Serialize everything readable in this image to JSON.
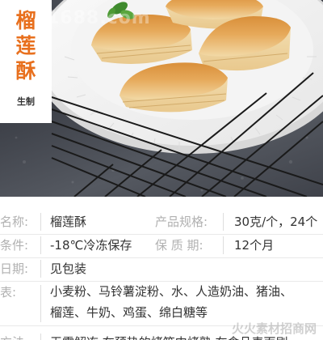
{
  "hero": {
    "title_chars": [
      "榴",
      "莲",
      "酥"
    ],
    "subtitle": "生制",
    "watermark_top": "1688.com",
    "watermark_bottom": "火火素材招商网"
  },
  "info": {
    "row1": {
      "label": "名称:",
      "value": "榴莲酥",
      "label2": "产品规格:",
      "value2": "30克/个，24个"
    },
    "row2": {
      "label": "条件:",
      "value": "-18℃冷冻保存",
      "label2": "保 质 期:",
      "value2": "12个月"
    },
    "row3": {
      "label": "日期:",
      "value": "见包装"
    },
    "row4": {
      "label": "表:",
      "line1": "小麦粉、马铃薯淀粉、水、人造奶油、猪油、",
      "line2": "榴莲、牛奶、鸡蛋、绵白糖等"
    },
    "row5": {
      "label": "方法:",
      "value": "无需解冻,在预热的烤箱中烤熟,在食品表面刷"
    }
  },
  "colors": {
    "title_accent": "#e8701e",
    "label_gray": "#b1b1b1",
    "text_dark": "#333333"
  }
}
